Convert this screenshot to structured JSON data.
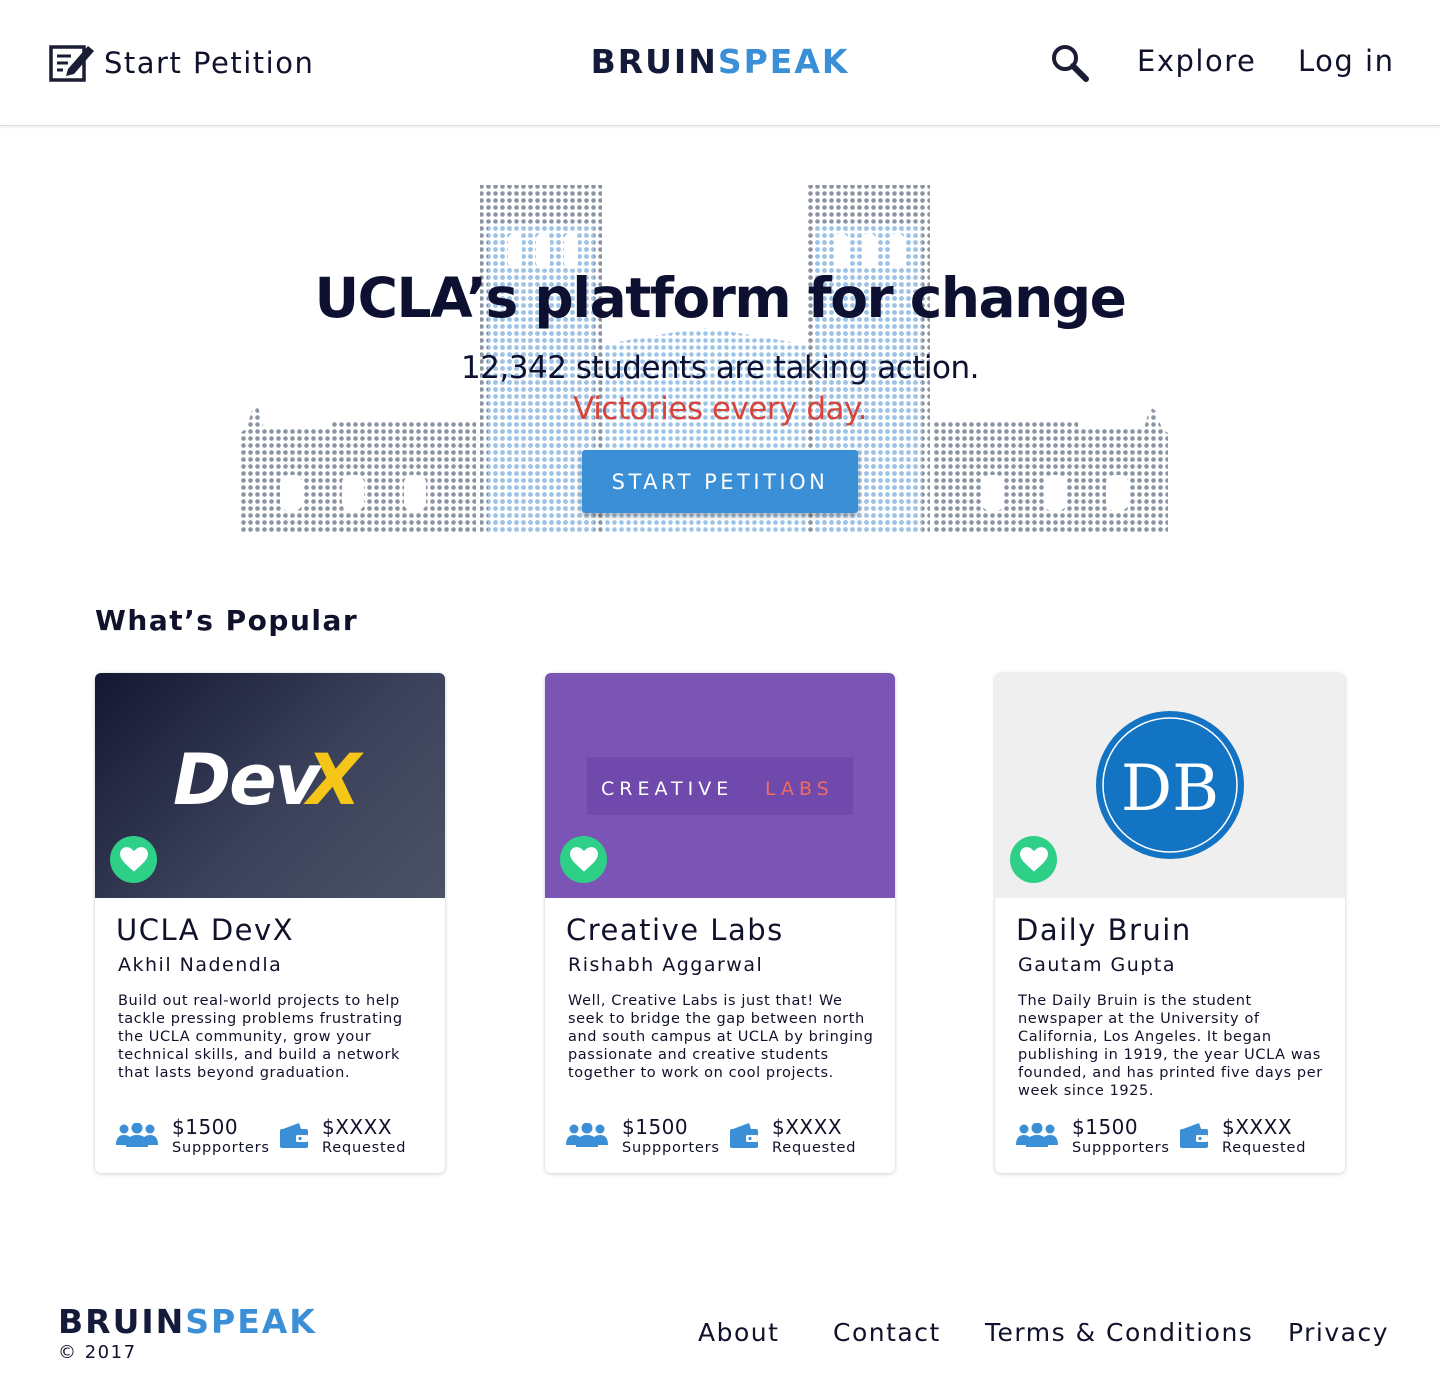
{
  "header": {
    "start_petition": "Start Petition",
    "brand_part1": "BRUIN",
    "brand_part2": "SPEAK",
    "explore": "Explore",
    "login": "Log in"
  },
  "hero": {
    "title": "UCLA’s platform for change",
    "subtitle": "12,342 students are taking action.",
    "tagline": "Victories every day.",
    "button": "START PETITION"
  },
  "popular": {
    "heading": "What’s Popular",
    "cards": [
      {
        "logo_text_1": "Dev",
        "logo_text_2": "X",
        "title": "UCLA DevX",
        "author": "Akhil Nadendla",
        "description": "Build out real-world projects to help tackle pressing problems frustrating the UCLA community, grow your technical skills, and build a network that lasts beyond graduation.",
        "supporters_value": "$1500",
        "supporters_label": "Suppporters",
        "requested_value": "$XXXX",
        "requested_label": "Requested"
      },
      {
        "logo_text_1": "CREATIVE",
        "logo_text_2": "LABS",
        "title": "Creative Labs",
        "author": "Rishabh Aggarwal",
        "description": "Well, Creative Labs is just that! We seek to bridge the gap between north and south campus at UCLA by bringing passionate and creative students together to work on cool projects.",
        "supporters_value": "$1500",
        "supporters_label": "Suppporters",
        "requested_value": "$XXXX",
        "requested_label": "Requested"
      },
      {
        "logo_text_1": "DB",
        "title": "Daily Bruin",
        "author": "Gautam Gupta",
        "description": "The Daily Bruin is the student newspaper at the University of California, Los Angeles. It began publishing in 1919, the year UCLA was founded, and has printed five days per week since 1925.",
        "supporters_value": "$1500",
        "supporters_label": "Suppporters",
        "requested_value": "$XXXX",
        "requested_label": "Requested"
      }
    ]
  },
  "footer": {
    "brand_part1": "BRUIN",
    "brand_part2": "SPEAK",
    "copyright": "© 2017",
    "links": [
      "About",
      "Contact",
      "Terms & Conditions",
      "Privacy"
    ]
  },
  "colors": {
    "brand_navy": "#131a3a",
    "brand_blue": "#3a8fd6",
    "accent_red": "#d6443b",
    "heart_green": "#2ecf87",
    "creative_labs_purple": "#7a55b6",
    "daily_bruin_blue": "#1474c4"
  },
  "icons": {
    "start_petition": "edit-note-icon",
    "search": "search-icon",
    "favorite": "heart-icon",
    "supporters": "group-icon",
    "requested": "wallet-icon"
  }
}
